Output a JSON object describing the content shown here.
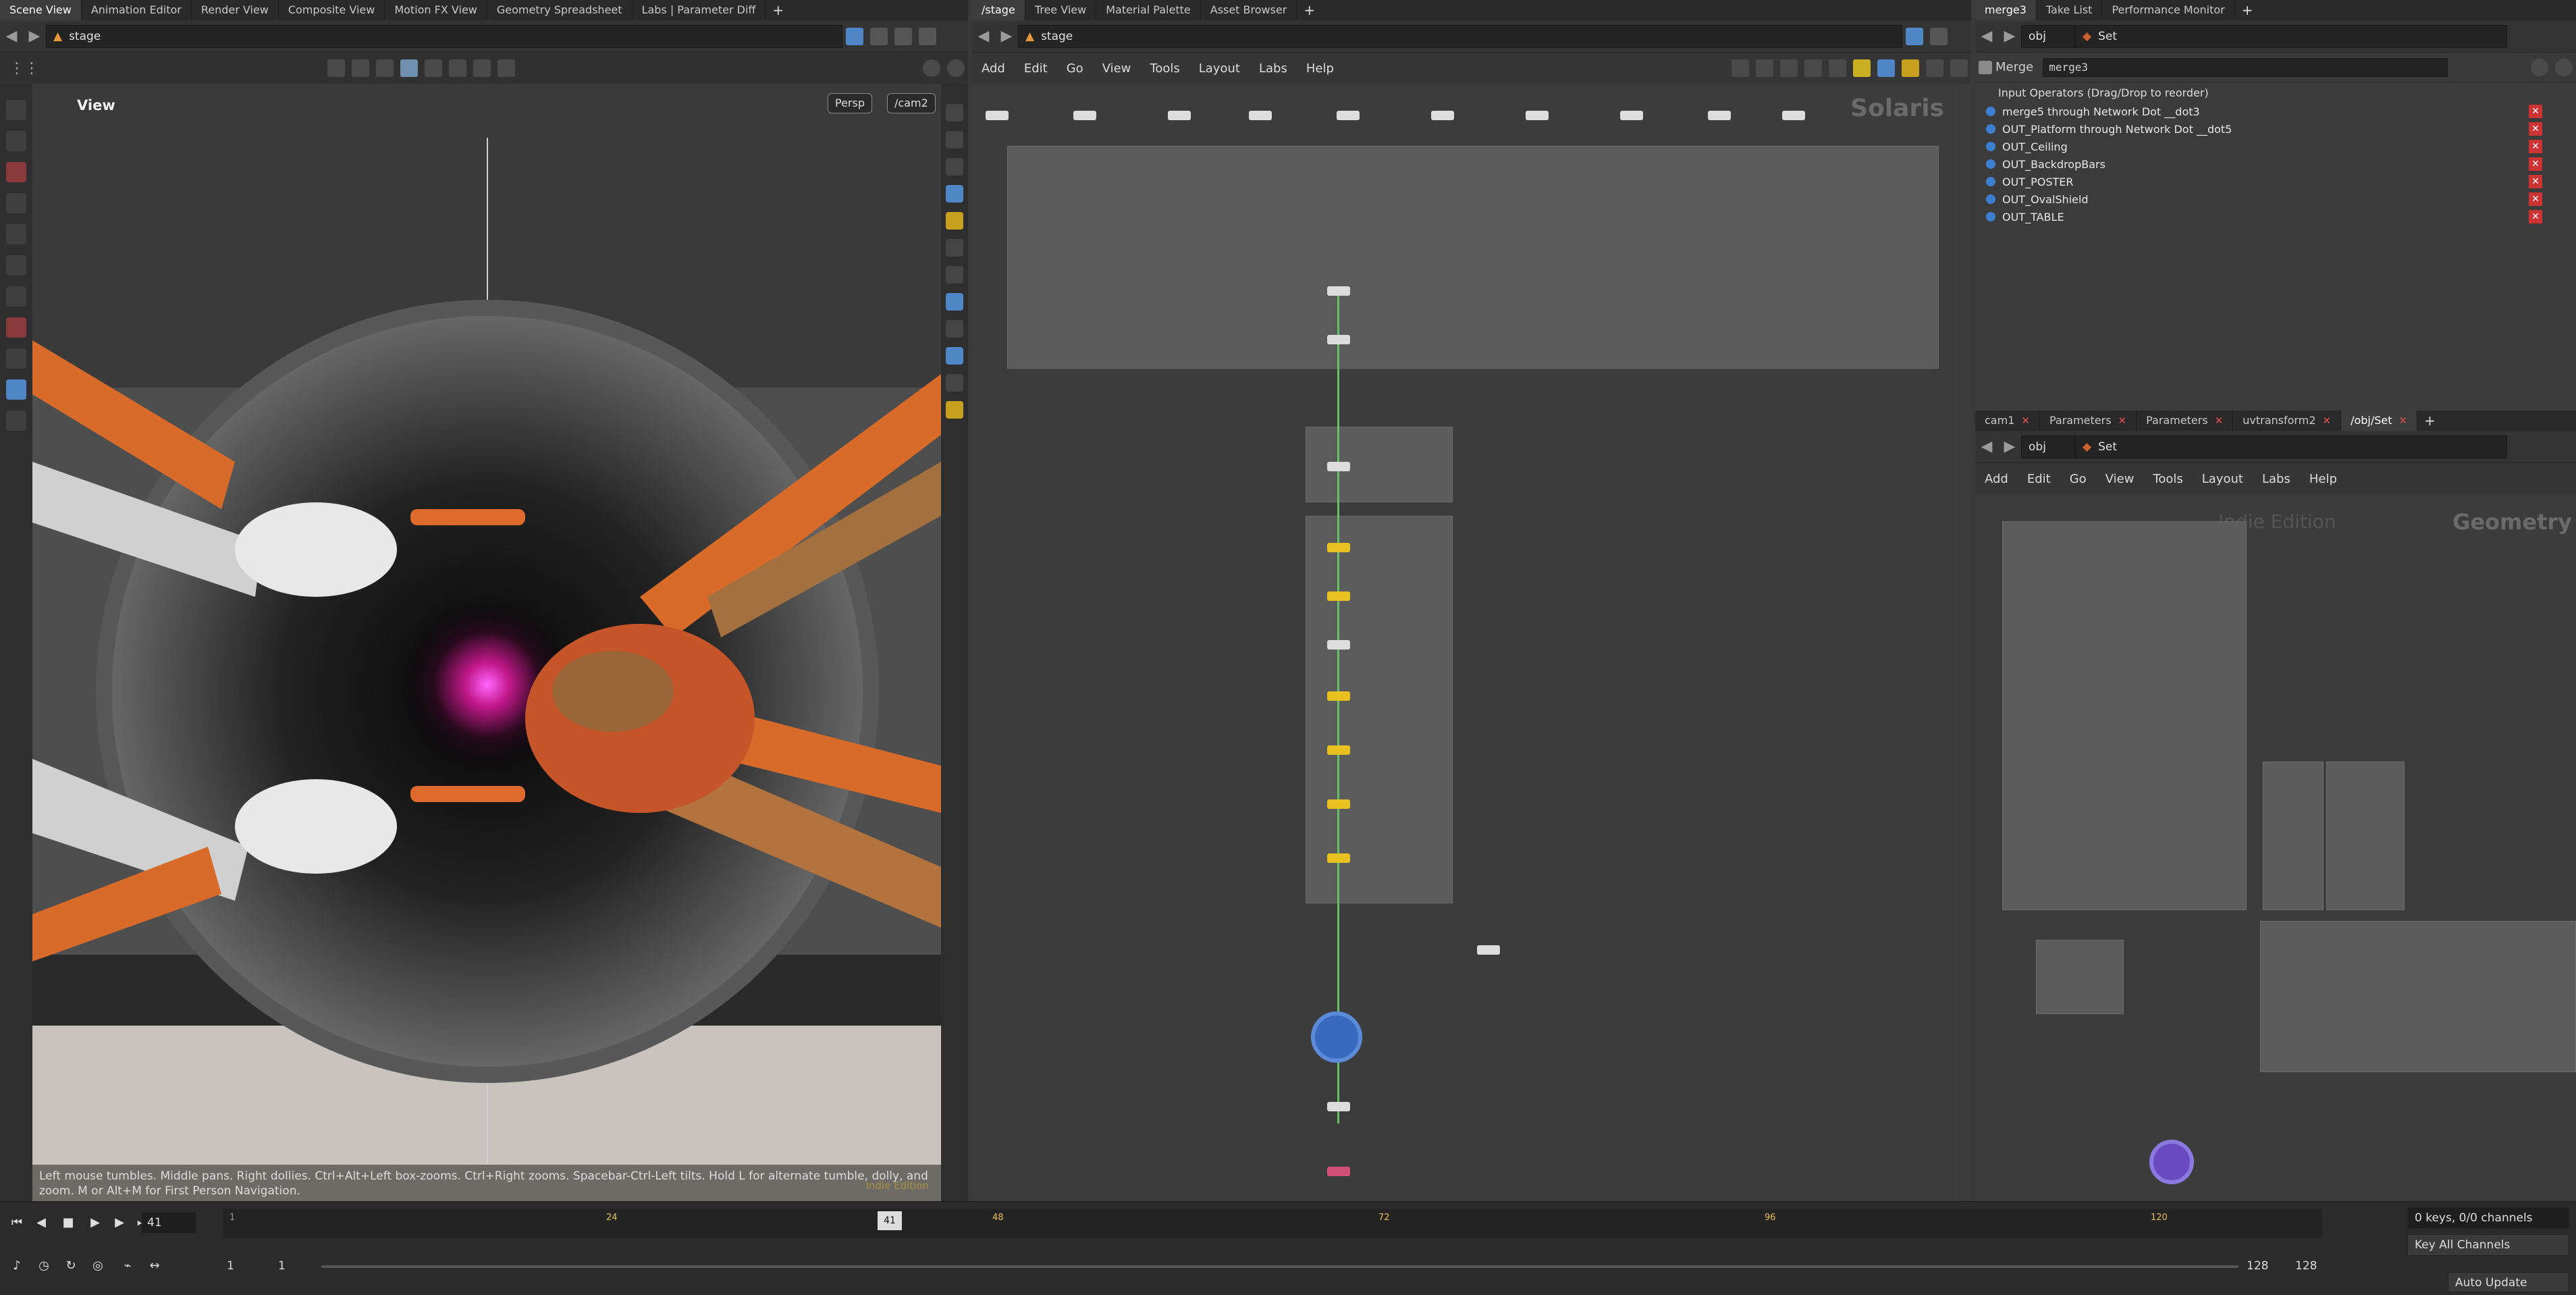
{
  "left_tabs": [
    "Scene View",
    "Animation Editor",
    "Render View",
    "Composite View",
    "Motion FX View",
    "Geometry Spreadsheet",
    "Labs | Parameter Diff"
  ],
  "left_path": "stage",
  "viewport": {
    "title": "View",
    "camera_mode": "Persp",
    "camera_name": "/cam2",
    "hint": "Left mouse tumbles. Middle pans. Right dollies. Ctrl+Alt+Left box-zooms. Ctrl+Right zooms. Spacebar-Ctrl-Left tilts. Hold L for alternate tumble, dolly, and zoom. M or Alt+M for First Person Navigation.",
    "edition_watermark": "Indie Edition"
  },
  "center_tabs": [
    "/stage",
    "Tree View",
    "Material Palette",
    "Asset Browser"
  ],
  "center_path": "stage",
  "center_menu": [
    "Add",
    "Edit",
    "Go",
    "View",
    "Tools",
    "Layout",
    "Labs",
    "Help"
  ],
  "center_context": "Solaris",
  "right_top_tabs": [
    "merge3",
    "Take List",
    "Performance Monitor"
  ],
  "right_top_path": "obj",
  "right_top_set": "Set",
  "merge_panel": {
    "type_label": "Merge",
    "node_name": "merge3",
    "header": "Input Operators (Drag/Drop to reorder)",
    "items": [
      "merge5 through Network Dot __dot3",
      "OUT_Platform through Network Dot __dot5",
      "OUT_Ceiling",
      "OUT_BackdropBars",
      "OUT_POSTER",
      "OUT_OvalShield",
      "OUT_TABLE"
    ]
  },
  "right_bottom_tabs": [
    "cam1",
    "Parameters",
    "Parameters",
    "uvtransform2",
    "/obj/Set"
  ],
  "right_bottom_path": "obj",
  "right_bottom_set": "Set",
  "right_bottom_menu": [
    "Add",
    "Edit",
    "Go",
    "View",
    "Tools",
    "Layout",
    "Labs",
    "Help"
  ],
  "right_bottom_context": "Geometry",
  "right_bottom_ghost": "Indie Edition",
  "timeline": {
    "current_frame": "41",
    "range_start": "1",
    "range_start2": "1",
    "range_end": "128",
    "range_end2": "128",
    "keys_info": "0 keys, 0/0 channels",
    "key_all_label": "Key All Channels",
    "auto_update_label": "Auto Update",
    "ruler_major": [
      "1",
      "24",
      "48",
      "72",
      "96",
      "120"
    ]
  },
  "colors": {
    "accent": "#e79a3b",
    "wire": "#6bbf6b",
    "danger": "#cc3333",
    "link": "#3c7fd0"
  }
}
